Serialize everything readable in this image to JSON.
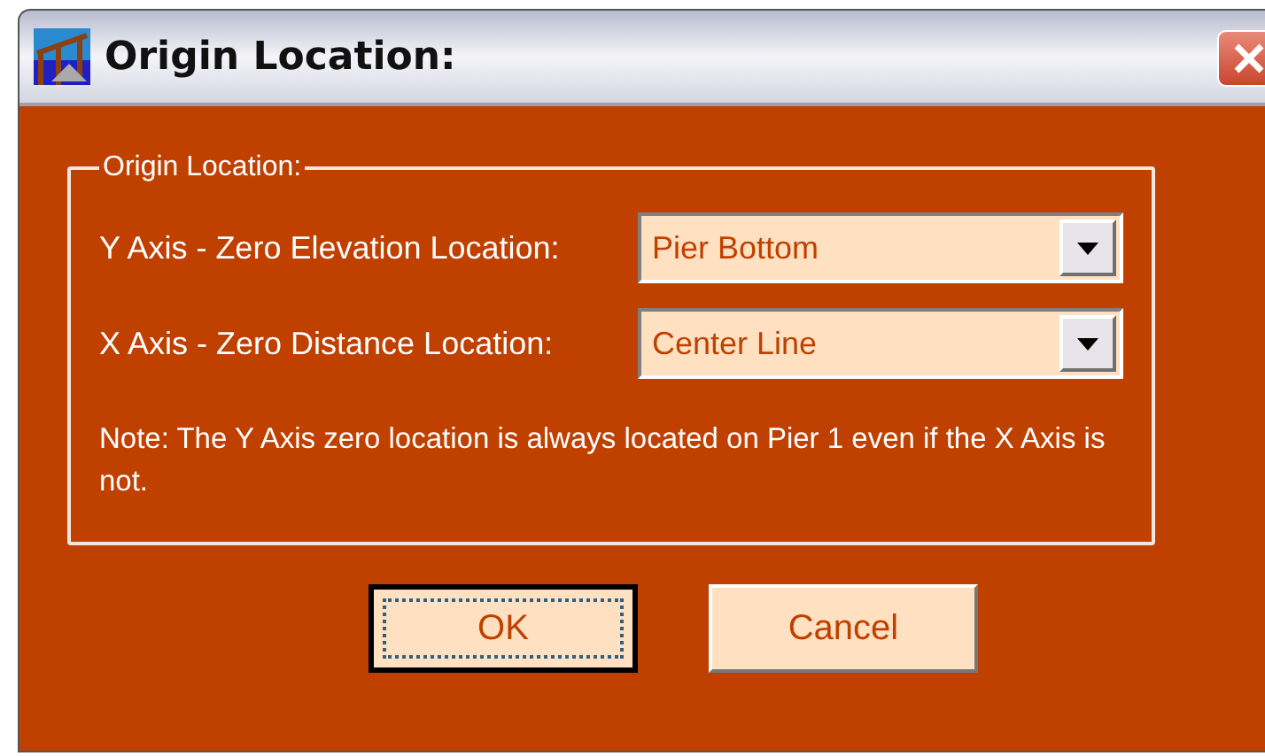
{
  "window": {
    "title": "Origin Location:"
  },
  "group": {
    "title": "Origin Location:",
    "fields": [
      {
        "label": "Y Axis - Zero Elevation Location:",
        "value": "Pier Bottom"
      },
      {
        "label": "X Axis - Zero Distance Location:",
        "value": "Center Line"
      }
    ],
    "note": "Note: The Y Axis zero location is always located on Pier 1 even if the X Axis is not."
  },
  "buttons": [
    {
      "label": "OK",
      "focused": true
    },
    {
      "label": "Cancel",
      "focused": false
    }
  ]
}
